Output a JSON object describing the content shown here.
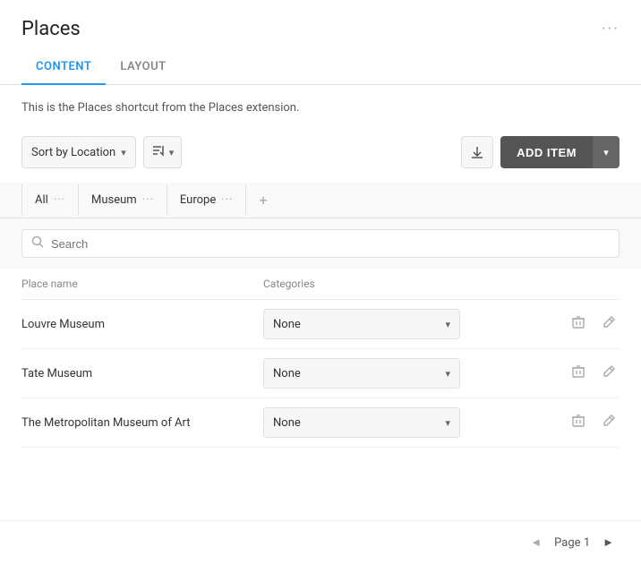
{
  "header": {
    "title": "Places",
    "more_icon": "···"
  },
  "tabs": [
    {
      "id": "content",
      "label": "CONTENT",
      "active": true
    },
    {
      "id": "layout",
      "label": "LAYOUT",
      "active": false
    }
  ],
  "description": "This is the Places shortcut from the Places extension.",
  "toolbar": {
    "sort_label": "Sort by Location",
    "sort_chevron": "▾",
    "sort_icon": "≡↑",
    "sort_icon_chevron": "▾",
    "download_icon": "⬇",
    "add_item_label": "ADD ITEM",
    "add_item_chevron": "▾"
  },
  "filter_tabs": [
    {
      "label": "All",
      "dots": "···"
    },
    {
      "label": "Museum",
      "dots": "···"
    },
    {
      "label": "Europe",
      "dots": "···"
    }
  ],
  "filter_add_icon": "+",
  "search": {
    "placeholder": "Search",
    "value": ""
  },
  "table": {
    "columns": [
      {
        "label": "Place name"
      },
      {
        "label": "Categories"
      }
    ],
    "rows": [
      {
        "name": "Louvre Museum",
        "category": "None"
      },
      {
        "name": "Tate Museum",
        "category": "None"
      },
      {
        "name": "The Metropolitan Museum of Art",
        "category": "None"
      }
    ]
  },
  "pagination": {
    "prev_icon": "◄",
    "label": "Page",
    "page": "1",
    "next_icon": "►"
  }
}
